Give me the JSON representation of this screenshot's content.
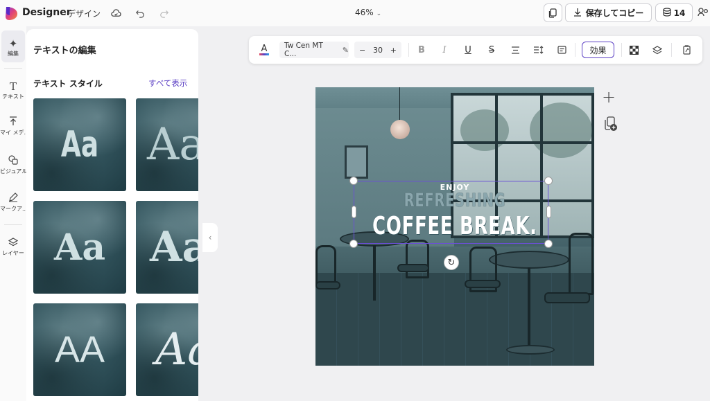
{
  "app": {
    "brand": "Designer",
    "design_label": "デザイン",
    "zoom": "46%",
    "save_label": "保存してコピー",
    "credits": "14"
  },
  "rail": {
    "items": [
      {
        "label": "編集",
        "icon": "sparkle-icon"
      },
      {
        "label": "テキスト",
        "icon": "text-icon"
      },
      {
        "label": "マイ メデ...",
        "icon": "upload-icon"
      },
      {
        "label": "ビジュアル",
        "icon": "visual-icon"
      },
      {
        "label": "マークア...",
        "icon": "pen-icon"
      },
      {
        "label": "レイヤー",
        "icon": "layers-icon"
      }
    ]
  },
  "panel": {
    "title": "テキストの編集",
    "section_title": "テキスト スタイル",
    "see_all": "すべて表示",
    "styles": [
      {
        "sample": "Aa"
      },
      {
        "sample": "Aa"
      },
      {
        "sample": "Aa"
      },
      {
        "sample": "Aa"
      },
      {
        "sample": "AA"
      },
      {
        "sample": "Aa"
      }
    ]
  },
  "toolbar": {
    "font_color_glyph": "A",
    "font_name": "Tw Cen MT C...",
    "font_size": "30",
    "minus": "−",
    "plus": "+",
    "bold": "B",
    "italic": "I",
    "underline": "U",
    "strike": "S",
    "effect_label": "効果"
  },
  "canvas": {
    "line1": "ENJOY",
    "line2": "REFRESHING",
    "line3": "COFFEE BREAK."
  },
  "colors": {
    "accent": "#5b3fc4",
    "selection": "#6b4fd6"
  }
}
